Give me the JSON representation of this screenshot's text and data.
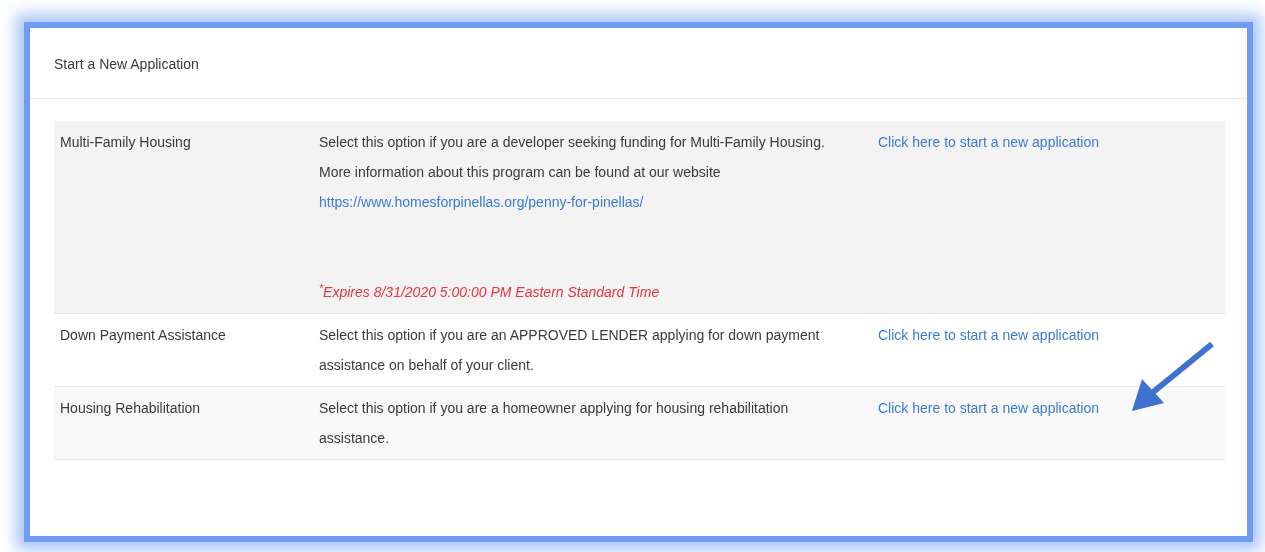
{
  "card": {
    "title": "Start a New Application"
  },
  "programs": [
    {
      "name": "Multi-Family Housing",
      "description": "Select this option if you are a developer seeking funding for Multi-Family Housing.",
      "more_info": "More information about this program can be found at our website",
      "website": "https://www.homesforpinellas.org/penny-for-pinellas/",
      "expires": "$^{*}$Expires 8/31/2020 5:00:00 PM Eastern Standard Time",
      "link": "Click here to start a new application",
      "pointed_at": false
    },
    {
      "name": "Down Payment Assistance",
      "description": "Select this option if you are an APPROVED LENDER applying for down payment assistance on behalf of your client.",
      "link": "Click here to start a new application",
      "pointed_at": false
    },
    {
      "name": "Housing Rehabilitation",
      "description": "Select this option if you are a homeowner applying for housing rehabilitation assistance.",
      "link": "Click here to start a new application",
      "pointed_at": true
    }
  ]
}
